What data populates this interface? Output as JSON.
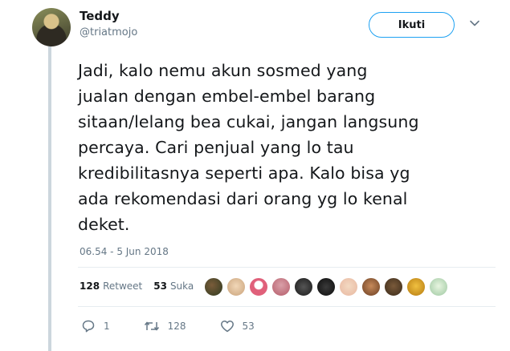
{
  "user": {
    "name": "Teddy",
    "handle": "@triatmojo"
  },
  "follow_button": "Ikuti",
  "tweet": {
    "lines": [
      "Jadi, kalo nemu akun sosmed yang",
      "jualan dengan embel-embel barang",
      "sitaan/lelang bea cukai, jangan langsung",
      "percaya. Cari penjual yang lo tau",
      "kredibilitasnya seperti apa. Kalo bisa yg",
      "ada rekomendasi dari orang yg lo kenal",
      "deket."
    ],
    "timestamp": "06.54 - 5 Jun 2018"
  },
  "stats": {
    "retweet_count": "128",
    "retweet_label": "Retweet",
    "like_count": "53",
    "like_label": "Suka"
  },
  "actions": {
    "reply_count": "1",
    "retweet_count": "128",
    "like_count": "53"
  },
  "colors": {
    "accent": "#1da1f2",
    "muted": "#657786",
    "divider": "#e6ecf0"
  }
}
